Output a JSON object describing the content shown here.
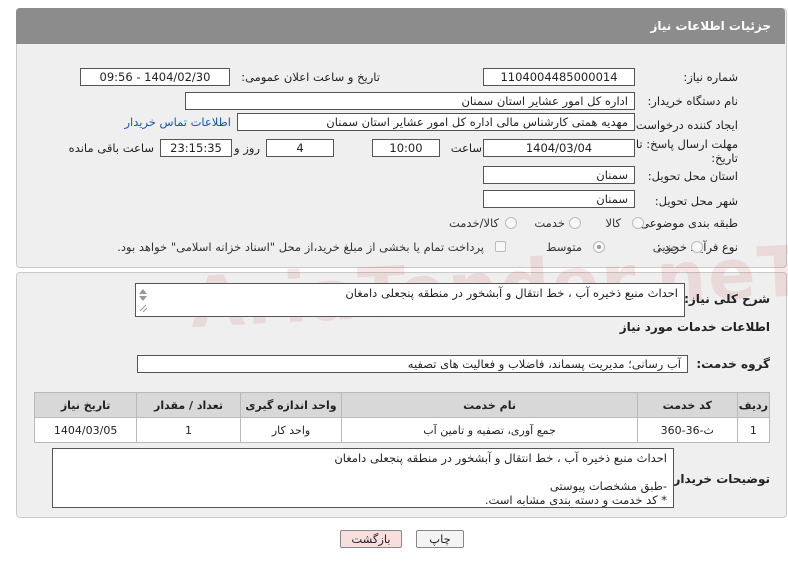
{
  "header": {
    "title": "جزئیات اطلاعات نیاز"
  },
  "form": {
    "need_number_label": "شماره نیاز:",
    "need_number": "1104004485000014",
    "announce_label": "تاریخ و ساعت اعلان عمومی:",
    "announce_value": "1404/02/30 - 09:56",
    "buyer_org_label": "نام دستگاه خریدار:",
    "buyer_org": "اداره کل امور عشایر استان سمنان",
    "creator_label": "ایجاد کننده درخواست:",
    "creator": "مهدیه همتی کارشناس مالی اداره کل امور عشایر استان سمنان",
    "contact_link": "اطلاعات تماس خریدار",
    "deadline_label_line1": "مهلت ارسال پاسخ: تا",
    "deadline_label_line2": "تاریخ:",
    "deadline_date": "1404/03/04",
    "time_label": "ساعت",
    "deadline_time": "10:00",
    "days_value": "4",
    "days_label": "روز و",
    "remaining_time": "23:15:35",
    "remaining_label": "ساعت باقی مانده",
    "province_label": "استان محل تحویل:",
    "province": "سمنان",
    "city_label": "شهر محل تحویل:",
    "city": "سمنان",
    "category_label": "طبقه بندی موضوعی:",
    "category_options": [
      "کالا",
      "خدمت",
      "کالا/خدمت"
    ],
    "category_selected": "خدمت",
    "process_label": "نوع فرآیند خرید :",
    "process_options": [
      "جزیی",
      "متوسط"
    ],
    "process_selected": "متوسط",
    "payment_note": "پرداخت تمام یا بخشی از مبلغ خرید،از محل \"اسناد خزانه اسلامی\" خواهد بود."
  },
  "details": {
    "summary_label": "شرح کلی نیاز:",
    "summary": "احداث منبع ذخیره آب ، خط انتقال و آبشخور در منطقه پنجعلی دامغان",
    "services_heading": "اطلاعات خدمات مورد نیاز",
    "service_group_label": "گروه خدمت:",
    "service_group": "آب رسانی؛ مدیریت پسماند، فاضلاب و فعالیت های تصفیه",
    "table": {
      "headers": [
        "ردیف",
        "کد خدمت",
        "نام خدمت",
        "واحد اندازه گیری",
        "تعداد / مقدار",
        "تاریخ نیاز"
      ],
      "rows": [
        [
          "1",
          "ث-36-360",
          "جمع آوری، تصفیه و تامین آب",
          "واحد کار",
          "1",
          "1404/03/05"
        ]
      ]
    },
    "buyer_notes_label": "توضیحات خریدار:",
    "buyer_notes": "احداث منبع ذخیره آب ، خط انتقال و آبشخور در منطقه پنجعلی دامغان\n\n-طبق مشخصات پیوستی\n* کد خدمت و دسته بندی مشابه است."
  },
  "buttons": {
    "print": "چاپ",
    "back": "بازگشت"
  },
  "colors": {
    "header_bg": "#8c8c8c",
    "panel_bg": "#efefef",
    "link": "#1a56b0",
    "back_btn_bg": "#f9dede"
  }
}
